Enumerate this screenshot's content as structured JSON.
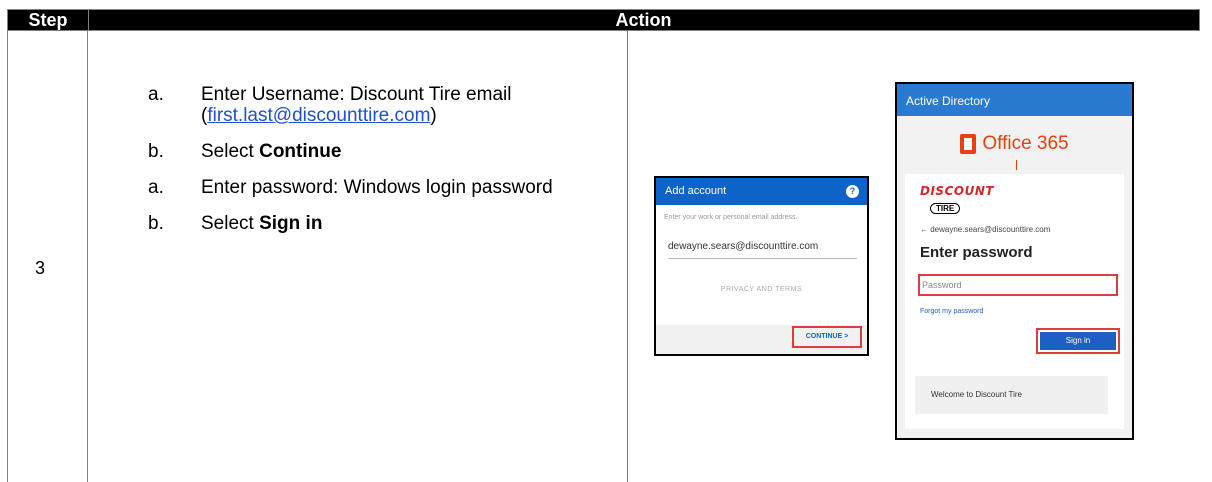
{
  "table": {
    "header_step": "Step",
    "header_action": "Action",
    "step_number": "3"
  },
  "instructions": [
    {
      "marker": "a.",
      "text_before": "Enter Username: Discount Tire email (",
      "link": "first.last@discounttire.com",
      "text_after": ")"
    },
    {
      "marker": "b.",
      "text_before": "Select ",
      "bold": "Continue"
    },
    {
      "marker": "a.",
      "text_before": "Enter password: Windows login password"
    },
    {
      "marker": "b.",
      "text_before": "Select ",
      "bold": "Sign in"
    }
  ],
  "add_account_screen": {
    "title": "Add account",
    "help_icon": "?",
    "hint": "Enter your work or personal email address.",
    "email_value": "dewayne.sears@discounttire.com",
    "privacy_link": "PRIVACY AND TERMS",
    "continue_button": "CONTINUE >",
    "accent_color": "#0e63c9",
    "highlight_color": "#e03c3c"
  },
  "office_screen": {
    "title_bar": "Active Directory",
    "product": "Office 365",
    "brand_top": "DISCOUNT",
    "brand_bottom": "TIRE",
    "back_email": "← dewayne.sears@discounttire.com",
    "heading": "Enter password",
    "password_placeholder": "Password",
    "forgot_link": "Forgot my password",
    "sign_in_button": "Sign in",
    "welcome_text": "Welcome to Discount Tire",
    "accent_color": "#2b7ad1",
    "office_color": "#e8410f"
  }
}
